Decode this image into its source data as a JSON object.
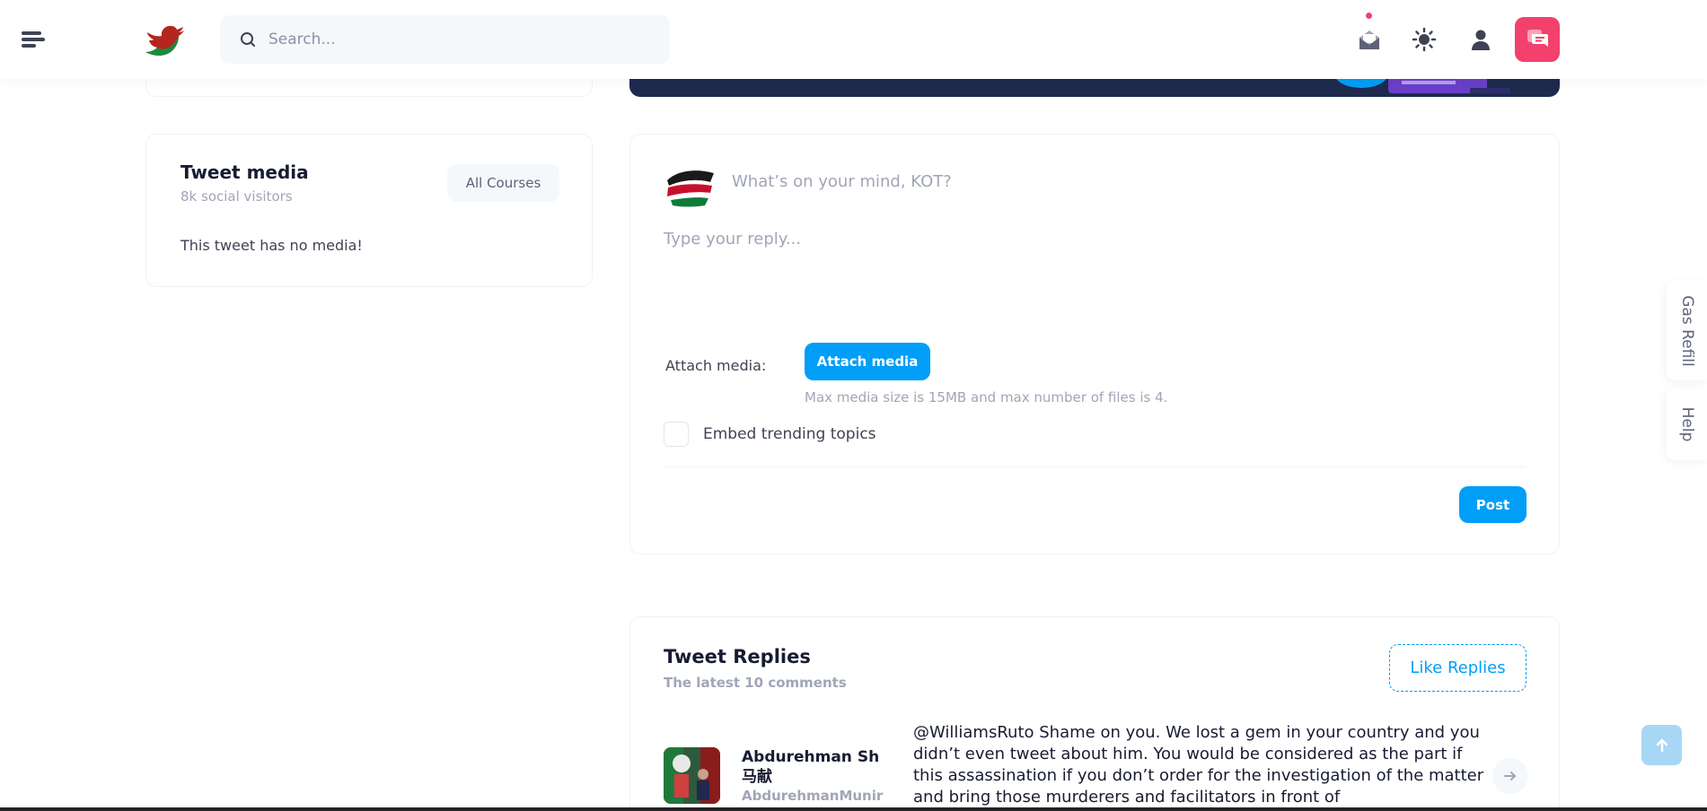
{
  "header": {
    "search_placeholder": "Search...",
    "icons": [
      "menu-icon",
      "logo-bird",
      "search-icon",
      "mail-icon",
      "theme-sun-icon",
      "user-icon",
      "chat-icon"
    ]
  },
  "tweet_media": {
    "title": "Tweet media",
    "subtitle": "8k social visitors",
    "button_label": "All Courses",
    "empty_text": "This tweet has no media!"
  },
  "compose": {
    "prompt": "What’s on your mind, KOT?",
    "reply_placeholder": "Type your reply...",
    "attach_label": "Attach media:",
    "attach_button": "Attach media",
    "attach_hint": "Max media size is 15MB and max number of files is 4.",
    "embed_label": "Embed trending topics",
    "post_button": "Post"
  },
  "replies": {
    "title": "Tweet Replies",
    "subtitle": "The latest 10 comments",
    "like_button": "Like Replies",
    "items": [
      {
        "name": "Abdurehman Sh 马献",
        "handle": "AbdurehmanMunir",
        "text": "@WilliamsRuto Shame on you. We lost a gem in your country and you didn’t even tweet about him. You would be considered as the part if this assassination if you don’t order for the investigation of the matter and bring those murderers and facilitators in front of"
      }
    ]
  },
  "side_tabs": {
    "gas": "Gas Refill",
    "help": "Help"
  },
  "colors": {
    "primary": "#009ef7",
    "danger": "#f1416c",
    "banner": "#1e2a4e"
  }
}
